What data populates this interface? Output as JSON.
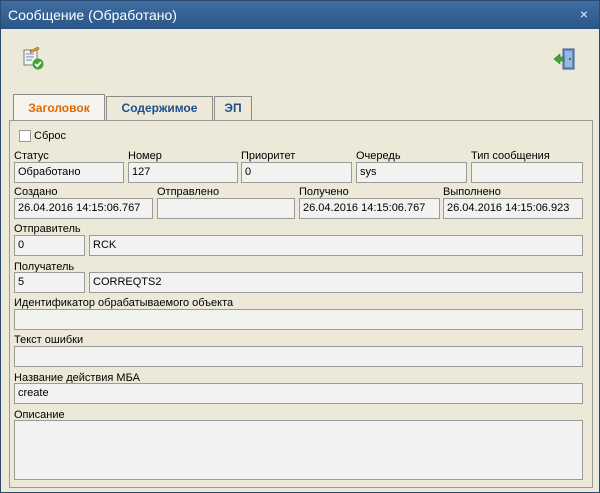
{
  "window": {
    "title": "Сообщение (Обработано)",
    "close_glyph": "×"
  },
  "toolbar": {
    "edit_icon": "document-edit-check-icon",
    "exit_icon": "exit-door-icon"
  },
  "tabs": [
    {
      "label": "Заголовок",
      "active": true
    },
    {
      "label": "Содержимое",
      "active": false
    },
    {
      "label": "ЭП",
      "active": false
    }
  ],
  "reset": {
    "label": "Сброс",
    "checked": false
  },
  "status": {
    "label": "Статус",
    "value": "Обработано"
  },
  "number": {
    "label": "Номер",
    "value": "127"
  },
  "priority": {
    "label": "Приоритет",
    "value": "0"
  },
  "queue": {
    "label": "Очередь",
    "value": "sys"
  },
  "message_type": {
    "label": "Тип сообщения",
    "value": ""
  },
  "created": {
    "label": "Создано",
    "value": "26.04.2016 14:15:06.767"
  },
  "sent": {
    "label": "Отправлено",
    "value": ""
  },
  "received": {
    "label": "Получено",
    "value": "26.04.2016 14:15:06.767"
  },
  "executed": {
    "label": "Выполнено",
    "value": "26.04.2016 14:15:06.923"
  },
  "sender": {
    "label": "Отправитель",
    "id": "0",
    "name": "RCK"
  },
  "recipient": {
    "label": "Получатель",
    "id": "5",
    "name": "CORREQTS2"
  },
  "object_id": {
    "label": "Идентификатор обрабатываемого объекта",
    "value": ""
  },
  "error_text": {
    "label": "Текст ошибки",
    "value": ""
  },
  "mba_action": {
    "label": "Название действия МБА",
    "value": "create"
  },
  "description": {
    "label": "Описание",
    "value": ""
  }
}
